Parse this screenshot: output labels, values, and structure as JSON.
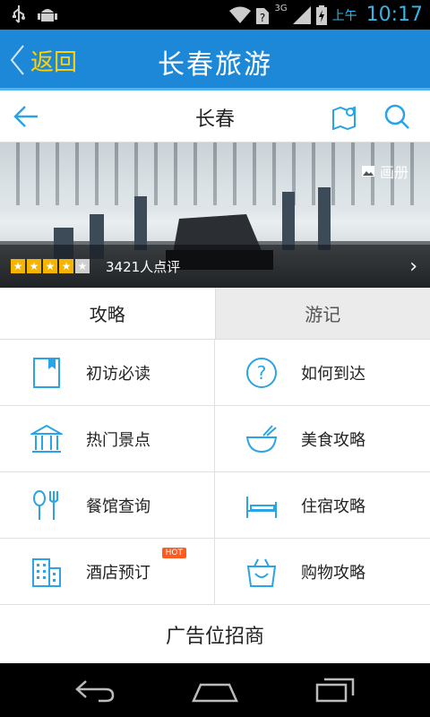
{
  "status_bar": {
    "ampm": "上午",
    "time": "10:17",
    "left_icons": [
      "usb-icon",
      "android-debug-icon"
    ],
    "right_icons": [
      "wifi-icon",
      "signal-icon",
      "battery-icon"
    ],
    "network_label": "3G"
  },
  "app_bar": {
    "back_label": "返回",
    "title": "长春旅游"
  },
  "sub_bar": {
    "city": "长春"
  },
  "banner": {
    "album_label": "画册",
    "rating_stars": 4,
    "rating_max": 5,
    "review_count": "3421人点评"
  },
  "tabs": [
    {
      "label": "攻略",
      "active": true
    },
    {
      "label": "游记",
      "active": false
    }
  ],
  "grid": [
    {
      "label": "初访必读",
      "icon": "bookmark-icon"
    },
    {
      "label": "如何到达",
      "icon": "question-icon"
    },
    {
      "label": "热门景点",
      "icon": "temple-icon"
    },
    {
      "label": "美食攻略",
      "icon": "bowl-icon"
    },
    {
      "label": "餐馆查询",
      "icon": "spoon-fork-icon"
    },
    {
      "label": "住宿攻略",
      "icon": "bed-icon"
    },
    {
      "label": "酒店预订",
      "icon": "building-icon",
      "badge": "HOT"
    },
    {
      "label": "购物攻略",
      "icon": "shopping-bag-icon"
    }
  ],
  "ad": {
    "label": "广告位招商"
  },
  "colors": {
    "app_bar": "#1e88d8",
    "back_text": "#ffd200",
    "icon_blue": "#2aa4e6",
    "star": "#f6b400",
    "hot_badge": "#ff5a1f"
  }
}
